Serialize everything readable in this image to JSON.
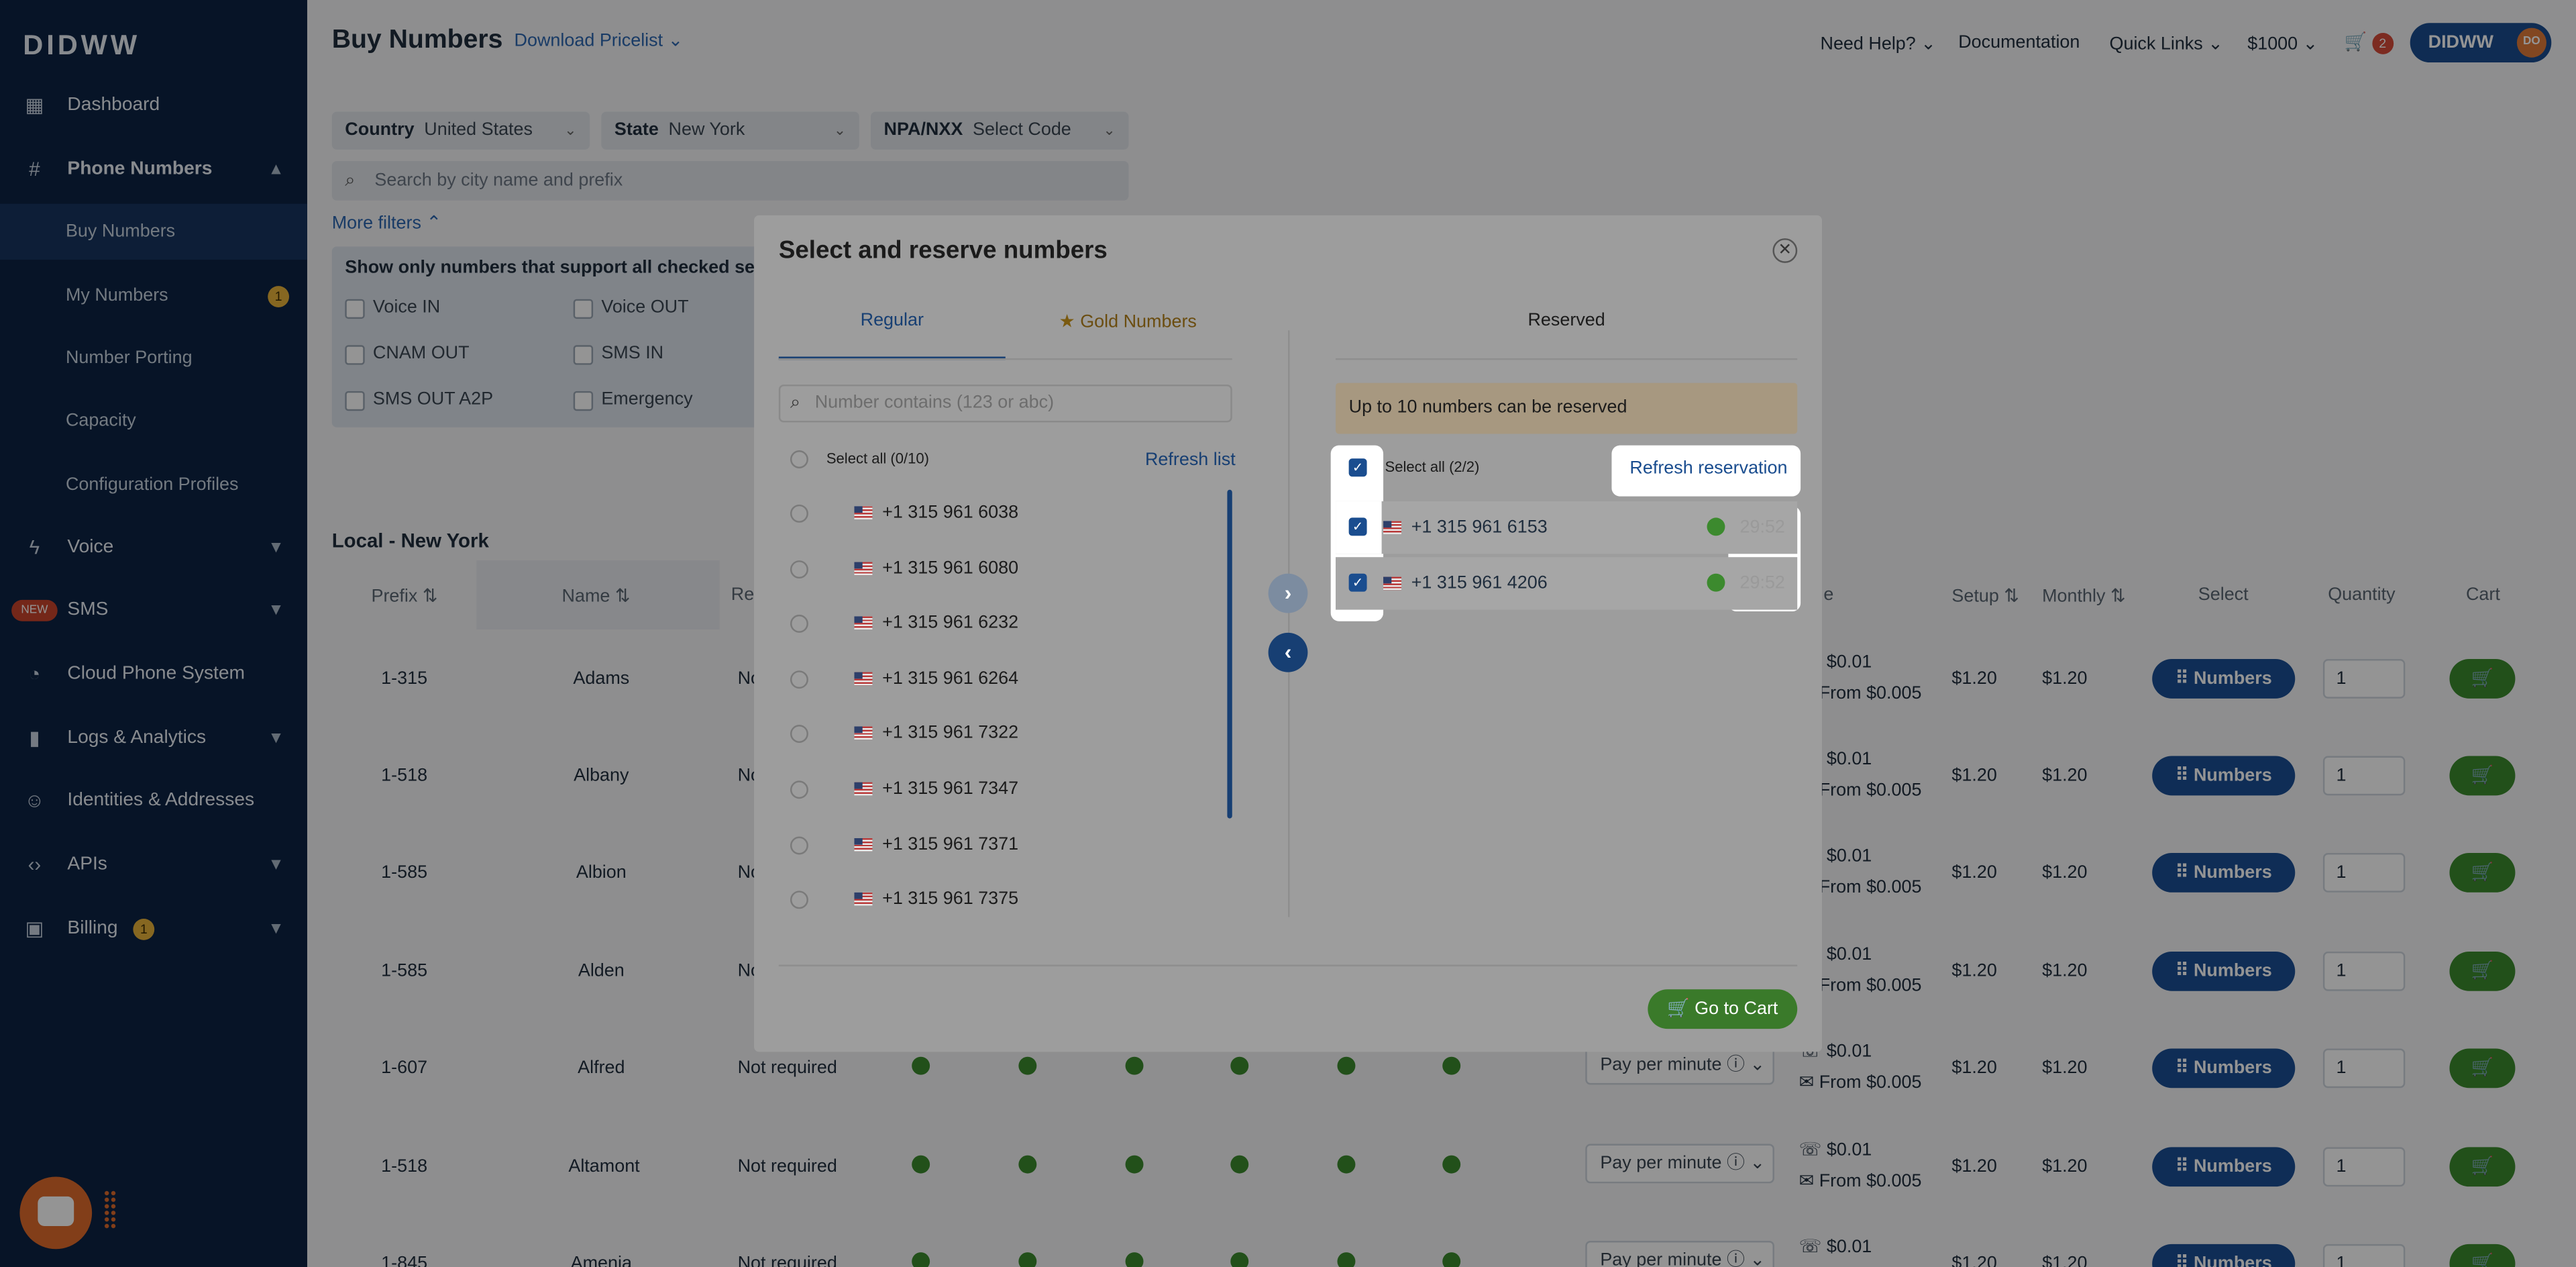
{
  "sidebar": {
    "logo": "DIDWW",
    "items": [
      {
        "label": "Dashboard",
        "icon": "grid-icon"
      },
      {
        "label": "Phone Numbers",
        "icon": "hash-icon"
      },
      {
        "label": "Buy Numbers"
      },
      {
        "label": "My Numbers",
        "badge": "1"
      },
      {
        "label": "Number Porting"
      },
      {
        "label": "Capacity"
      },
      {
        "label": "Configuration Profiles"
      },
      {
        "label": "Voice",
        "icon": "voice-icon"
      },
      {
        "label": "SMS",
        "badge": "NEW"
      },
      {
        "label": "Cloud Phone System",
        "icon": "cloud-phone-icon"
      },
      {
        "label": "Logs & Analytics",
        "icon": "chart-icon"
      },
      {
        "label": "Identities & Addresses",
        "icon": "person-icon"
      },
      {
        "label": "APIs",
        "icon": "code-icon"
      },
      {
        "label": "Billing",
        "badge": "1"
      }
    ]
  },
  "header": {
    "title": "Buy Numbers",
    "pricelist": "Download Pricelist",
    "need_help": "Need Help?",
    "documentation": "Documentation",
    "quick_links": "Quick Links",
    "balance": "$1000",
    "cart_count": "2",
    "account": "DIDWW",
    "avatar": "DO"
  },
  "filters": {
    "country_label": "Country",
    "country_value": "United States",
    "state_label": "State",
    "state_value": "New York",
    "npa_label": "NPA/NXX",
    "npa_value": "Select Code",
    "search_placeholder": "Search by city name and prefix",
    "more_filters": "More filters",
    "services_title": "Show only numbers that support all checked services",
    "services": [
      "Voice IN",
      "Voice OUT",
      "CNAM OUT",
      "SMS IN",
      "SMS OUT A2P",
      "Emergency"
    ]
  },
  "table": {
    "section_title": "Local - New York",
    "headers": [
      "Prefix",
      "Name",
      "Re",
      "e",
      "Setup",
      "Monthly",
      "Select",
      "Quantity",
      "Cart"
    ],
    "button_label": "Numbers",
    "rows": [
      {
        "prefix": "1-315",
        "name": "Adams",
        "req": "No",
        "rate1": "$0.01",
        "rate2": "From $0.005",
        "setup": "$1.20",
        "monthly": "$1.20",
        "qty": "1"
      },
      {
        "prefix": "1-518",
        "name": "Albany",
        "req": "No",
        "rate1": "$0.01",
        "rate2": "From $0.005",
        "setup": "$1.20",
        "monthly": "$1.20",
        "qty": "1"
      },
      {
        "prefix": "1-585",
        "name": "Albion",
        "req": "No",
        "rate1": "$0.01",
        "rate2": "From $0.005",
        "setup": "$1.20",
        "monthly": "$1.20",
        "qty": "1"
      },
      {
        "prefix": "1-585",
        "name": "Alden",
        "req": "No",
        "rate1": "$0.01",
        "rate2": "From $0.005",
        "setup": "$1.20",
        "monthly": "$1.20",
        "qty": "1"
      },
      {
        "prefix": "1-607",
        "name": "Alfred",
        "req": "Not required",
        "pay": "Pay per minute",
        "rate1": "$0.01",
        "rate2": "From $0.005",
        "setup": "$1.20",
        "monthly": "$1.20",
        "qty": "1"
      },
      {
        "prefix": "1-518",
        "name": "Altamont",
        "req": "Not required",
        "pay": "Pay per minute",
        "rate1": "$0.01",
        "rate2": "From $0.005",
        "setup": "$1.20",
        "monthly": "$1.20",
        "qty": "1"
      },
      {
        "prefix": "1-845",
        "name": "Amenia",
        "req": "Not required",
        "pay": "Pay per minute",
        "rate1": "$0.01",
        "rate2": "",
        "setup": "$1.20",
        "monthly": "$1.20",
        "qty": "1"
      }
    ]
  },
  "modal": {
    "title": "Select and reserve numbers",
    "tab_regular": "Regular",
    "tab_gold": "Gold Numbers",
    "tab_reserved": "Reserved",
    "search_placeholder": "Number contains (123 or abc)",
    "select_all": "Select all (0/10)",
    "refresh_list": "Refresh list",
    "available": [
      "+1 315 961 6038",
      "+1 315 961 6080",
      "+1 315 961 6232",
      "+1 315 961 6264",
      "+1 315 961 7322",
      "+1 315 961 7347",
      "+1 315 961 7371",
      "+1 315 961 7375"
    ],
    "notice": "Up to 10 numbers can be reserved",
    "reserved_select_all": "Select all (2/2)",
    "refresh_reservation": "Refresh reservation",
    "reserved": [
      {
        "number": "+1 315 961 6153",
        "timer": "29:52"
      },
      {
        "number": "+1 315 961 4206",
        "timer": "29:52"
      }
    ],
    "go_to_cart": "Go to Cart"
  }
}
